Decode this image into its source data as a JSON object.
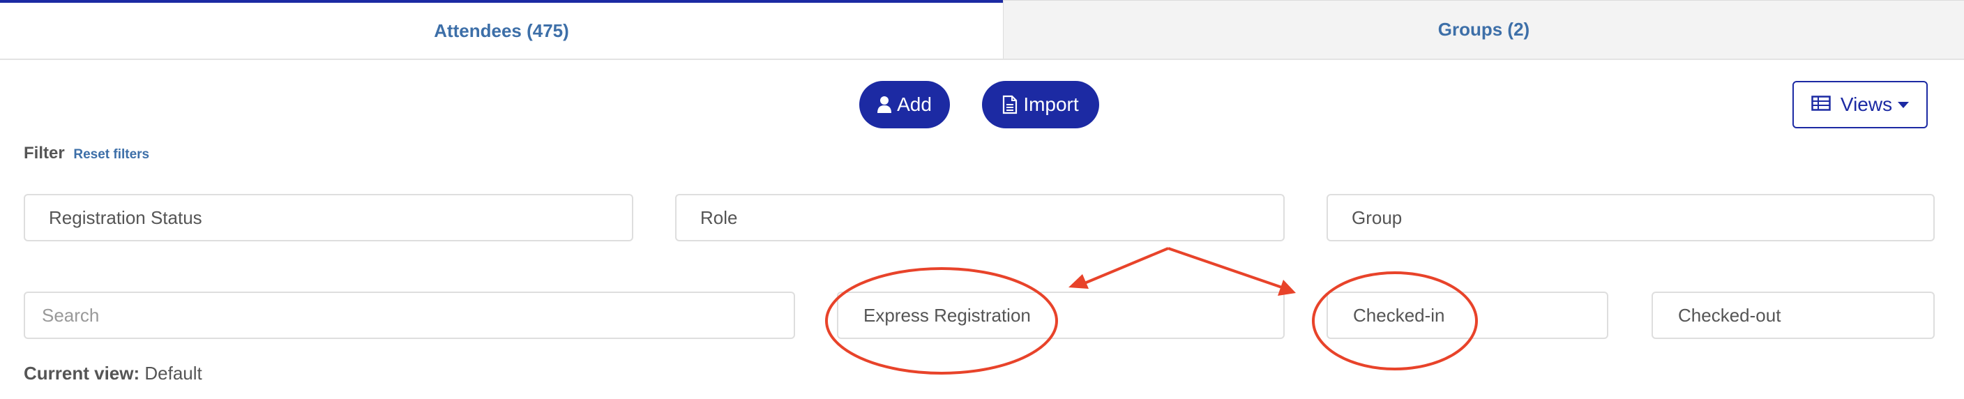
{
  "tabs": [
    {
      "label": "Attendees (475)",
      "active": true
    },
    {
      "label": "Groups (2)",
      "active": false
    }
  ],
  "actions": {
    "add_label": "Add",
    "import_label": "Import",
    "views_label": "Views"
  },
  "filter": {
    "label": "Filter",
    "reset_label": "Reset filters"
  },
  "fields": {
    "registration_status": "Registration Status",
    "role": "Role",
    "group": "Group",
    "search_placeholder": "Search",
    "express_registration": "Express Registration",
    "checked_in": "Checked-in",
    "checked_out": "Checked-out"
  },
  "current_view": {
    "label": "Current view:",
    "value": "Default"
  },
  "icons": {
    "add": "user-icon",
    "import": "document-icon",
    "views": "table-icon",
    "views_dropdown": "caret-down-icon"
  },
  "colors": {
    "primary": "#1c2aa3",
    "link": "#3d6fa8",
    "annotation": "#e8432a"
  }
}
